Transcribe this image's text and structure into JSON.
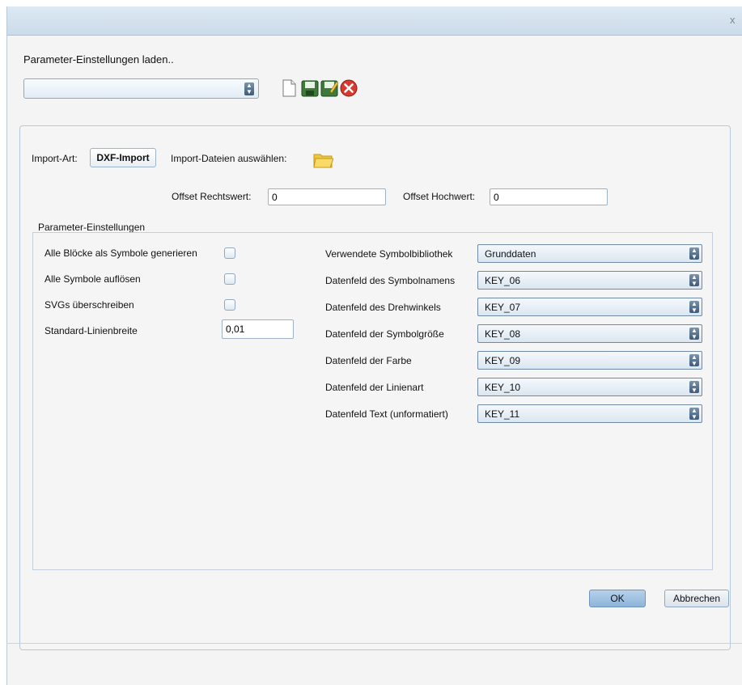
{
  "window": {
    "close": "x"
  },
  "loader": {
    "label": "Parameter-Einstellungen laden..",
    "selected": "",
    "icons": [
      "new-file-icon",
      "save-icon",
      "save-as-icon",
      "delete-icon"
    ]
  },
  "import": {
    "type_label": "Import-Art:",
    "type_button": "DXF-Import",
    "files_label": "Import-Dateien auswählen:",
    "offset_right_label": "Offset Rechtswert:",
    "offset_right_value": "0",
    "offset_high_label": "Offset Hochwert:",
    "offset_high_value": "0"
  },
  "params": {
    "group_label": "Parameter-Einstellungen",
    "left": [
      {
        "label": "Alle Blöcke als Symbole generieren",
        "checked": false
      },
      {
        "label": "Alle Symbole auflösen",
        "checked": false
      },
      {
        "label": "SVGs überschreiben",
        "checked": false
      }
    ],
    "line_width_label": "Standard-Linienbreite",
    "line_width_value": "0,01",
    "right": [
      {
        "label": "Verwendete Symbolbibliothek",
        "value": "Grunddaten"
      },
      {
        "label": "Datenfeld des Symbolnamens",
        "value": "KEY_06"
      },
      {
        "label": "Datenfeld des Drehwinkels",
        "value": "KEY_07"
      },
      {
        "label": "Datenfeld der Symbolgröße",
        "value": "KEY_08"
      },
      {
        "label": "Datenfeld der Farbe",
        "value": "KEY_09"
      },
      {
        "label": "Datenfeld der Linienart",
        "value": "KEY_10"
      },
      {
        "label": "Datenfeld Text (unformatiert)",
        "value": "KEY_11"
      }
    ]
  },
  "footer": {
    "ok": "OK",
    "cancel": "Abbrechen"
  }
}
